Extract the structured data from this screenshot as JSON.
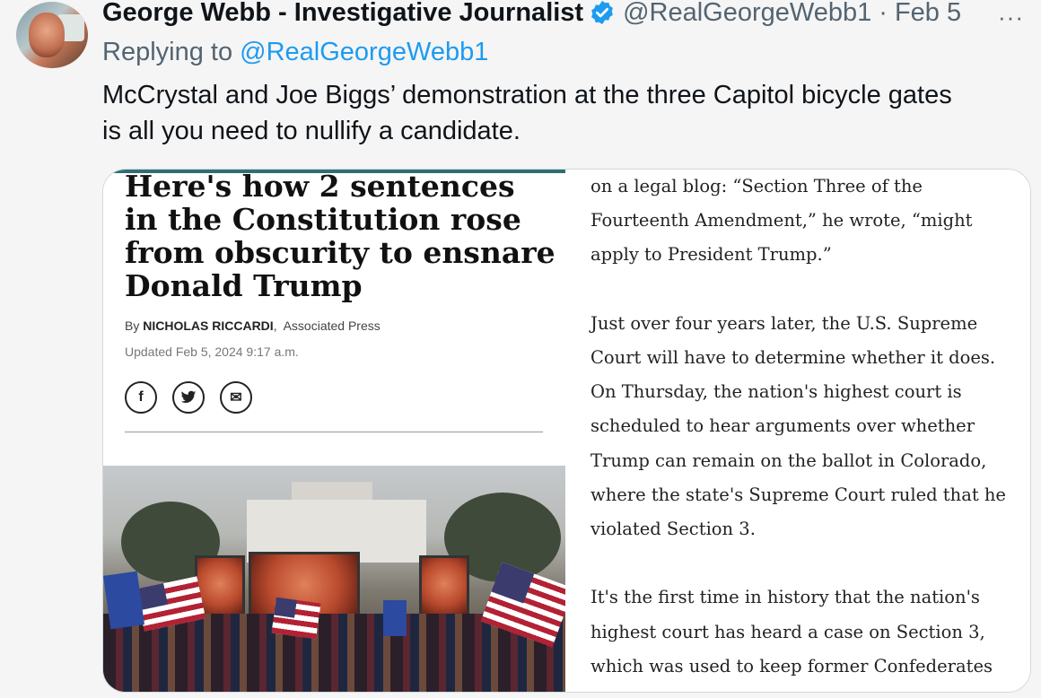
{
  "tweet": {
    "display_name": "George Webb - Investigative Journalist",
    "handle": "@RealGeorgeWebb1",
    "separator": "·",
    "date": "Feb 5",
    "more_label": "···",
    "reply_prefix": "Replying to",
    "reply_handle": "@RealGeorgeWebb1",
    "text_line1": "McCrystal and Joe Biggs’ demonstration at the three Capitol bicycle gates",
    "text_line2": "is all you need to nullify a candidate.",
    "verified_color": "#1d9bf0"
  },
  "article": {
    "headline": "Here's how 2 sentences in the Constitution rose from obscurity to ensnare Donald Trump",
    "byline_prefix": "By",
    "author": "NICHOLAS RICCARDI",
    "byline_sep": ",",
    "outlet": "Associated Press",
    "updated": "Updated Feb 5, 2024 9:17 a.m.",
    "share_icons": [
      "facebook-icon",
      "twitter-icon",
      "email-icon"
    ],
    "share_glyphs": {
      "facebook": "f",
      "twitter": "t",
      "email": "✉"
    },
    "accent_color": "#2f6e74",
    "paragraphs": [
      "on a legal blog: “Section Three of the Fourteenth Amendment,” he wrote, “might apply to President Trump.”",
      "Just over four years later, the U.S. Supreme Court will have to determine whether it does. On Thursday, the nation's highest court is scheduled to hear arguments over whether Trump can remain on the ballot in Colorado, where the state's Supreme Court ruled that he violated Section 3.",
      "It's the first time in history that the nation's highest court has heard a case on Section 3, which was used to keep former Confederates"
    ]
  }
}
